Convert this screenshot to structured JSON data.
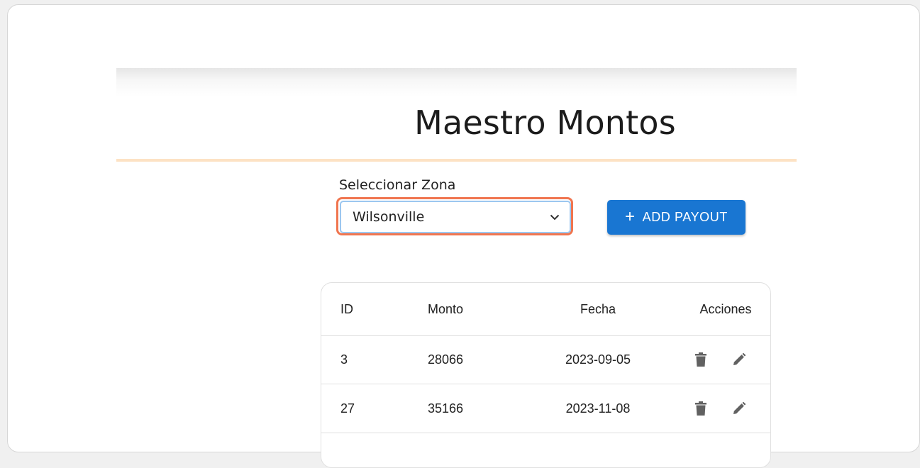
{
  "page": {
    "title": "Maestro Montos"
  },
  "zone": {
    "label": "Seleccionar Zona",
    "selected": "Wilsonville"
  },
  "actions": {
    "add_label": "ADD PAYOUT"
  },
  "table": {
    "headers": {
      "id": "ID",
      "monto": "Monto",
      "fecha": "Fecha",
      "acciones": "Acciones"
    },
    "rows": [
      {
        "id": "3",
        "monto": "28066",
        "fecha": "2023-09-05"
      },
      {
        "id": "27",
        "monto": "35166",
        "fecha": "2023-11-08"
      }
    ]
  },
  "colors": {
    "accent": "#1976d2",
    "highlight": "#f0754f",
    "header_rule": "#fde2c4",
    "icon": "#616161"
  },
  "icons": {
    "select": "chevron-down-icon",
    "add": "plus-icon",
    "delete": "trash-icon",
    "edit": "pencil-icon"
  }
}
